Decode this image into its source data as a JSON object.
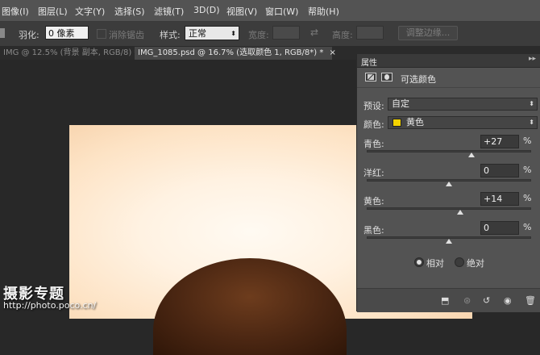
{
  "menu": [
    "图像(I)",
    "图层(L)",
    "文字(Y)",
    "选择(S)",
    "滤镜(T)",
    "3D(D)",
    "视图(V)",
    "窗口(W)",
    "帮助(H)"
  ],
  "options": {
    "feather_label": "羽化:",
    "feather_value": "0 像素",
    "antialias_label": "消除锯齿",
    "style_label": "样式:",
    "style_value": "正常",
    "width_label": "宽度:",
    "height_label": "高度:",
    "refine_edge_label": "调整边缘..."
  },
  "tabs": [
    {
      "label": "IMG @ 12.5% (背景 副本, RGB/8) *",
      "close": "×",
      "active": false
    },
    {
      "label": "IMG_1085.psd @ 16.7% (选取颜色 1, RGB/8*) *",
      "close": "×",
      "active": true
    }
  ],
  "panel": {
    "title": "属性",
    "collapse": "▸▸",
    "adjustment_title": "可选颜色",
    "preset_label": "预设:",
    "preset_value": "自定",
    "color_label": "颜色:",
    "color_value": "黄色",
    "color_swatch": "#f4d300",
    "sliders": [
      {
        "label": "青色:",
        "value": "+27",
        "unit": "%",
        "level": 27
      },
      {
        "label": "洋红:",
        "value": "0",
        "unit": "%",
        "level": 0
      },
      {
        "label": "黄色:",
        "value": "+14",
        "unit": "%",
        "level": 14
      },
      {
        "label": "黑色:",
        "value": "0",
        "unit": "%",
        "level": 0
      }
    ],
    "method": {
      "relative_label": "相对",
      "absolute_label": "绝对",
      "selected": "relative"
    }
  },
  "watermark": {
    "line1": "摄影专题",
    "line2": "http://photo.poco.cn/"
  }
}
